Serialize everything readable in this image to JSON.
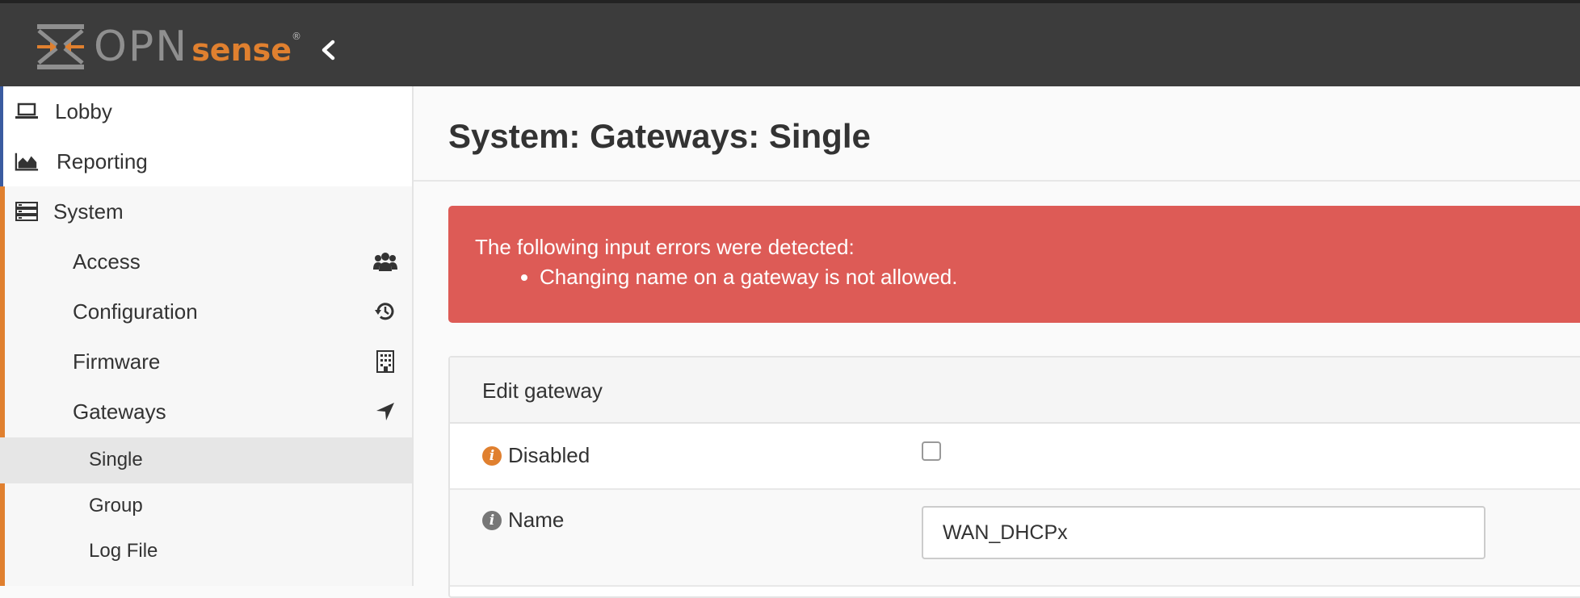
{
  "app": {
    "logo_text_opn": "OPN",
    "logo_text_sense": "sense",
    "logo_reg": "®",
    "accent_color": "#e0802f",
    "navbar_color": "#3c3c3c"
  },
  "sidebar": {
    "top_items": [
      {
        "label": "Lobby",
        "icon": "laptop-icon"
      },
      {
        "label": "Reporting",
        "icon": "area-chart-icon"
      }
    ],
    "system": {
      "label": "System",
      "icon": "server-icon"
    },
    "sub_items": [
      {
        "label": "Access",
        "icon": "users-icon"
      },
      {
        "label": "Configuration",
        "icon": "history-icon"
      },
      {
        "label": "Firmware",
        "icon": "building-icon"
      },
      {
        "label": "Gateways",
        "icon": "location-arrow-icon"
      }
    ],
    "gateway_items": [
      {
        "label": "Single",
        "active": true
      },
      {
        "label": "Group",
        "active": false
      },
      {
        "label": "Log File",
        "active": false
      }
    ]
  },
  "main": {
    "page_title": "System: Gateways: Single",
    "alert": {
      "heading": "The following input errors were detected:",
      "errors": [
        "Changing name on a gateway is not allowed."
      ],
      "color": "#dd5b56"
    },
    "panel": {
      "title": "Edit gateway",
      "fields": {
        "disabled": {
          "label": "Disabled",
          "checked": false,
          "info_color": "#e0802f"
        },
        "name": {
          "label": "Name",
          "value": "WAN_DHCPx",
          "info_color": "#777777"
        }
      }
    }
  }
}
